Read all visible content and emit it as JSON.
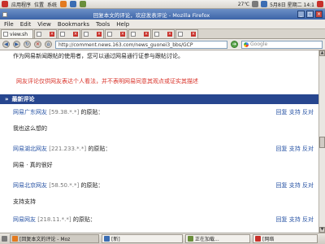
{
  "top_panel": {
    "items": [
      "应用程序",
      "位置",
      "系统"
    ],
    "indicator": "27℃",
    "datetime": "5月8日 星期二 14:1",
    "colors": {
      "apps": "#c8312b",
      "browser": "#e37a1f",
      "mail": "#3b6db3"
    }
  },
  "window": {
    "title": "回复本文的评论，欢迎发表评论 - Mozilla Firefox",
    "buttons": [
      "_",
      "□",
      "×"
    ]
  },
  "menu": [
    "File",
    "Edit",
    "View",
    "Bookmarks",
    "Tools",
    "Help"
  ],
  "tabs": {
    "active_label": "view.sh",
    "count": 8
  },
  "nav": {
    "url": "http://comment.news.163.com/news_guonei3_bbs/GCP",
    "search_placeholder": "Google"
  },
  "content": {
    "notice1": "作为网易新闻跟帖的使用者，您可以通过网易通行证参与跟帖讨论。",
    "notice2": "网友评论仅供网友表达个人看法，并不表明网易同意其观点或证实其描述",
    "section_title": "最新评论",
    "comments": [
      {
        "user": "网易广东网友",
        "ip": "[59.38.*.*]",
        "verb": "的原贴：",
        "actions": "回复  支持  反对",
        "body": "我也这么想的"
      },
      {
        "user": "网易湖北网友",
        "ip": "[221.233.*.*]",
        "verb": "的原贴：",
        "actions": "回复  支持  反对",
        "body": "网易 · 真的很好"
      },
      {
        "user": "网易北京网友",
        "ip": "[58.50.*.*]",
        "verb": "的原贴：",
        "actions": "回复  支持  反对",
        "body": "支持支持"
      },
      {
        "user": "网易网友",
        "ip": "[218.11.*.*]",
        "verb": "的原贴：",
        "actions": "回复  支持  反对",
        "body": ""
      }
    ]
  },
  "scroll": {
    "up": "▲",
    "down": "▼"
  },
  "taskbar": {
    "items": [
      "[回复本文的评论 - Moz",
      "[新]",
      "正在加载...",
      "[网络"
    ]
  }
}
